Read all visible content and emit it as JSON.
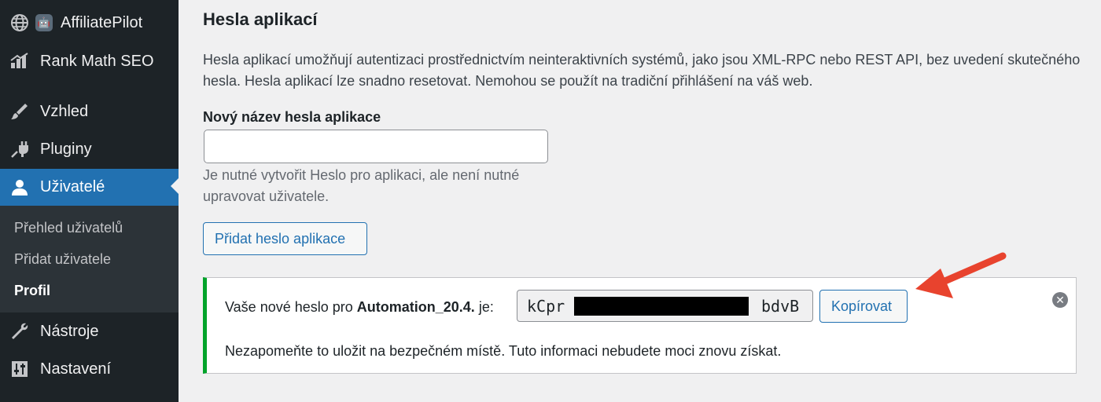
{
  "sidebar": {
    "items": [
      {
        "label": "AffiliatePilot",
        "icon": "globe-icon"
      },
      {
        "label": "Rank Math SEO",
        "icon": "rank-math-icon"
      },
      {
        "label": "Vzhled",
        "icon": "paintbrush-icon"
      },
      {
        "label": "Pluginy",
        "icon": "plugin-icon"
      },
      {
        "label": "Uživatelé",
        "icon": "user-icon",
        "active": true
      },
      {
        "label": "Nástroje",
        "icon": "wrench-icon"
      },
      {
        "label": "Nastavení",
        "icon": "settings-sliders-icon"
      }
    ],
    "submenu": [
      {
        "label": "Přehled uživatelů"
      },
      {
        "label": "Přidat uživatele"
      },
      {
        "label": "Profil",
        "current": true
      }
    ]
  },
  "app_passwords": {
    "title": "Hesla aplikací",
    "description": "Hesla aplikací umožňují autentizaci prostřednictvím neinteraktivních systémů, jako jsou XML-RPC nebo REST API, bez uvedení skutečného hesla. Hesla aplikací lze snadno resetovat. Nemohou se použít na tradiční přihlášení na váš web.",
    "name_label": "Nový název hesla aplikace",
    "name_value": "",
    "hint": "Je nutné vytvořit Heslo pro aplikaci, ale není nutné upravovat uživatele.",
    "add_button": "Přidat heslo aplikace"
  },
  "notice": {
    "prefix": "Vaše nové heslo pro ",
    "app_name": "Automation_20.4.",
    "suffix": " je:",
    "password_start": "kCpr",
    "password_end": "bdvB",
    "copy_button": "Kopírovat",
    "warning": "Nezapomeňte to uložit na bezpečném místě. Tuto informaci nebudete moci znovu získat.",
    "dismiss_icon": "dismiss-icon"
  },
  "colors": {
    "sidebar_bg": "#1d2327",
    "active_blue": "#2271b1",
    "success_green": "#00a32a",
    "annotation_red": "#e8432e"
  }
}
